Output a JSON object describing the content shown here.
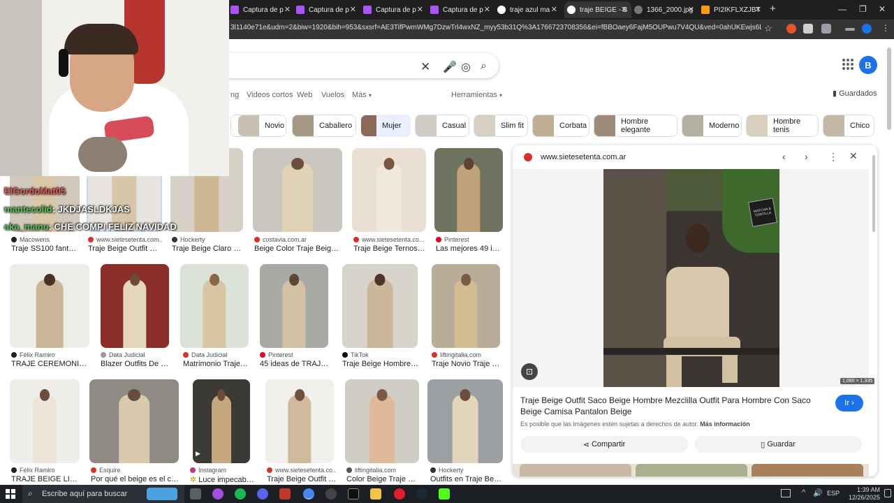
{
  "browser": {
    "tabs": [
      {
        "label": "Captura de p",
        "active": false
      },
      {
        "label": "Captura de p",
        "active": false
      },
      {
        "label": "Captura de p",
        "active": false
      },
      {
        "label": "Captura de p",
        "active": false
      },
      {
        "label": "traje azul ma",
        "active": false
      },
      {
        "label": "traje BEIGE - B",
        "active": true
      },
      {
        "label": "1366_2000.jpg",
        "active": false
      },
      {
        "label": "PI2IKFLXZJBT",
        "active": false
      }
    ],
    "new_tab": "+",
    "url": "3l1140e71e&udm=2&biw=1920&bih=953&sxsrf=AE3TifPwmWMg7DzwTrl4wxNZ_myy53b31Q%3A1766723708356&ei=fBBOaey6FajM5OUPwu7V4QU&ved=0ahUKEwjs6LXYttqRAxUoJ..."
  },
  "search": {
    "tabs": [
      "Videos cortos",
      "Web",
      "Vuelos",
      "Más"
    ],
    "tools": "Herramientas",
    "saved": "Guardados",
    "avatar_letter": "B",
    "chips": [
      "Novio",
      "Caballero",
      "Mujer",
      "Casual",
      "Slim fit",
      "Corbata",
      "Hombre elegante",
      "Moderno",
      "Hombre tenis",
      "Chico"
    ]
  },
  "results": [
    {
      "source": "Macowens",
      "title": "Traje SS100 fantas..."
    },
    {
      "source": "www.sietesetenta.com...",
      "title": "Traje Beige Outfit Sa..."
    },
    {
      "source": "Hockerty",
      "title": "Traje Beige Claro co..."
    },
    {
      "source": "costavia.com.ar",
      "title": "Beige Color Traje Beige H..."
    },
    {
      "source": "www.sietesetenta.co...",
      "title": "Traje Beige Ternos B..."
    },
    {
      "source": "Pinterest",
      "title": "Las mejores 49 ide..."
    },
    {
      "source": "Félix Ramiro",
      "title": "TRAJE CEREMONIA 1..."
    },
    {
      "source": "Data Judicial",
      "title": "Blazer Outfits De Ve..."
    },
    {
      "source": "Data Judicial",
      "title": "Matrimonio Trajes ..."
    },
    {
      "source": "Pinterest",
      "title": "45 ideas de TRAJE ..."
    },
    {
      "source": "TikTok",
      "title": "Traje Beige Hombre | T..."
    },
    {
      "source": "liftingitalia.com",
      "title": "Traje Novio Traje De..."
    },
    {
      "source": "Félix Ramiro",
      "title": "TRAJE BEIGE LIN..."
    },
    {
      "source": "Esquire",
      "title": "Por qué el beige es el col..."
    },
    {
      "source": "Instagram",
      "title": "Luce impecabl..."
    },
    {
      "source": "www.sietesetenta.co...",
      "title": "Traje Beige Outfit S..."
    },
    {
      "source": "liftingitalia.com",
      "title": "Color Beige Traje De..."
    },
    {
      "source": "Hockerty",
      "title": "Outfits en Traje Beig..."
    }
  ],
  "panel": {
    "source": "www.sietesetenta.com.ar",
    "dims": "1,080 × 1,335",
    "title": "Traje Beige Outfit Saco Beige Hombre Mezclilla Outfit Para Hombre Con Saco Beige Camisa Pantalon Beige",
    "go_label": "Ir",
    "notice": "Es posible que las imágenes estén sujetas a derechos de autor.",
    "more_info": "Más información",
    "share_label": "Compartir",
    "save_label": "Guardar",
    "sign_text": "MATCHA & TORTILLA"
  },
  "webcam": {
    "chat": [
      {
        "user": "ElGordoMat05",
        "msg": ""
      },
      {
        "user": "mantecolid",
        "msg": "JKDJASLDKJAS"
      },
      {
        "user": "aka_manu",
        "msg": "CHE COMPI FELIZ NAVIDAD"
      }
    ]
  },
  "taskbar": {
    "search_placeholder": "Escribe aquí para buscar",
    "lang": "ESP",
    "time": "1:39 AM",
    "date": "12/26/2025"
  },
  "colors": {
    "accent": "#1a73e8",
    "beige": "#d8c6a8",
    "dark": "#1f1f1f"
  }
}
